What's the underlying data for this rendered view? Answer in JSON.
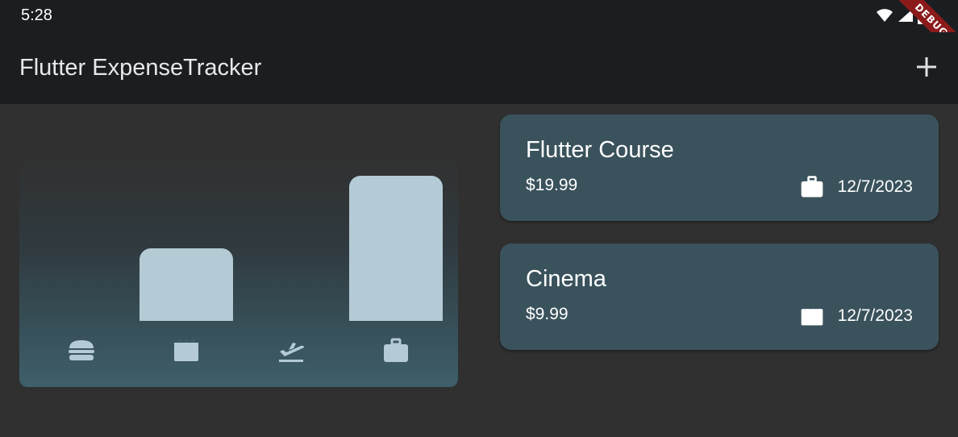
{
  "status_bar": {
    "time": "5:28"
  },
  "debug_banner": "DEBUG",
  "app_bar": {
    "title": "Flutter ExpenseTracker",
    "action_icon": "add-icon"
  },
  "chart": {
    "categories": [
      {
        "name": "food",
        "icon": "burger-icon",
        "fill": 0.0
      },
      {
        "name": "leisure",
        "icon": "movie-icon",
        "fill": 0.5
      },
      {
        "name": "travel",
        "icon": "flight-takeoff-icon",
        "fill": 0.0
      },
      {
        "name": "work",
        "icon": "briefcase-icon",
        "fill": 1.0
      }
    ]
  },
  "expenses": [
    {
      "title": "Flutter Course",
      "amount": "$19.99",
      "date": "12/7/2023",
      "icon": "briefcase-icon"
    },
    {
      "title": "Cinema",
      "amount": "$9.99",
      "date": "12/7/2023",
      "icon": "movie-icon"
    }
  ],
  "colors": {
    "background": "#303030",
    "app_bar": "#1b1e21",
    "card": "#3a525c",
    "bar": "#b4cbd6",
    "debug": "#8b1a1a"
  }
}
